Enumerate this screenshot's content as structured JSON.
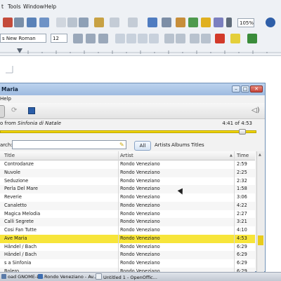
{
  "writer": {
    "menu": [
      "t",
      "Tools",
      "Window",
      "Help"
    ],
    "font_name": "s New Roman",
    "font_size": "12",
    "zoom": "105%"
  },
  "player": {
    "title": "Maria",
    "menu_help": "Help",
    "now_playing_prefix": "o from ",
    "now_playing_album": "Sinfonia di Natale",
    "time": "4:41 of 4:53",
    "progress_fraction": 0.96,
    "search_label": "arch:",
    "search_value": "",
    "filters": [
      "All",
      "Artists",
      "Albums",
      "Titles"
    ],
    "columns": {
      "title": "Title",
      "artist": "Artist",
      "time": "Time"
    },
    "tracks": [
      {
        "title": "Controdanze",
        "artist": "Rondo Veneziano",
        "time": "2:59"
      },
      {
        "title": "Nuvole",
        "artist": "Rondo Veneziano",
        "time": "2:25"
      },
      {
        "title": "Seduzione",
        "artist": "Rondo Veneziano",
        "time": "2:32"
      },
      {
        "title": "Perla Del Mare",
        "artist": "Rondo Veneziano",
        "time": "1:58"
      },
      {
        "title": "Reverie",
        "artist": "Rondo Veneziano",
        "time": "3:06"
      },
      {
        "title": "Canaletto",
        "artist": "Rondo Veneziano",
        "time": "4:22"
      },
      {
        "title": "Magica Melodia",
        "artist": "Rondo Veneziano",
        "time": "2:27"
      },
      {
        "title": "Calli Segrete",
        "artist": "Rondo Veneziano",
        "time": "3:21"
      },
      {
        "title": "Cosi Fan Tutte",
        "artist": "Rondo Veneziano",
        "time": "4:10"
      },
      {
        "title": "Ave Maria",
        "artist": "Rondo Veneziano",
        "time": "4:53",
        "selected": true
      },
      {
        "title": "Händel / Bach",
        "artist": "Rondo Veneziano",
        "time": "6:29"
      },
      {
        "title": "Händel / Bach",
        "artist": "Rondo Veneziano",
        "time": "6:29"
      },
      {
        "title": "s a Sinfonia",
        "artist": "Rondo Veneziano",
        "time": "6:29"
      },
      {
        "title": "Bolero",
        "artist": "Rondo Veneziano",
        "time": "6:29"
      }
    ]
  },
  "taskbar": {
    "items": [
      "oad GNOME-L...",
      "Rondo Veneziano - Av...",
      "Untitled 1 - OpenOffic..."
    ]
  },
  "colors": {
    "selection": "#f7e53a",
    "seek": "#f0d500",
    "accent": "#9fbbe0"
  }
}
